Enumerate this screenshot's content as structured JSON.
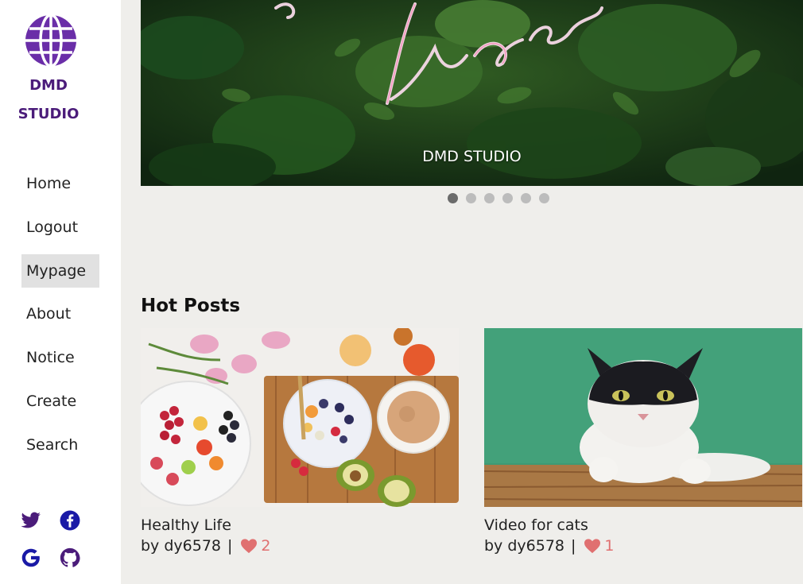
{
  "sidebar": {
    "brand_line1": "DMD",
    "brand_line2": "STUDIO",
    "nav": [
      {
        "label": "Home"
      },
      {
        "label": "Logout"
      },
      {
        "label": "Mypage"
      },
      {
        "label": "About"
      },
      {
        "label": "Notice"
      },
      {
        "label": "Create"
      },
      {
        "label": "Search"
      }
    ],
    "active_item": "Mypage",
    "social_icons": [
      "twitter-icon",
      "facebook-icon",
      "google-icon",
      "github-icon"
    ]
  },
  "hero": {
    "caption": "DMD STUDIO",
    "slide_count": 6,
    "active_slide": 1
  },
  "hot_posts": {
    "title": "Hot Posts",
    "posts": [
      {
        "title": "Healthy Life",
        "author": "by dy6578",
        "separator": "|",
        "likes": "2"
      },
      {
        "title": "Video for cats",
        "author": "by dy6578",
        "separator": "|",
        "likes": "1"
      }
    ]
  },
  "colors": {
    "brand_purple": "#4b1c7a",
    "social_blue": "#1a1aa6",
    "heart": "#e07070",
    "page_bg": "#efeeeb"
  }
}
